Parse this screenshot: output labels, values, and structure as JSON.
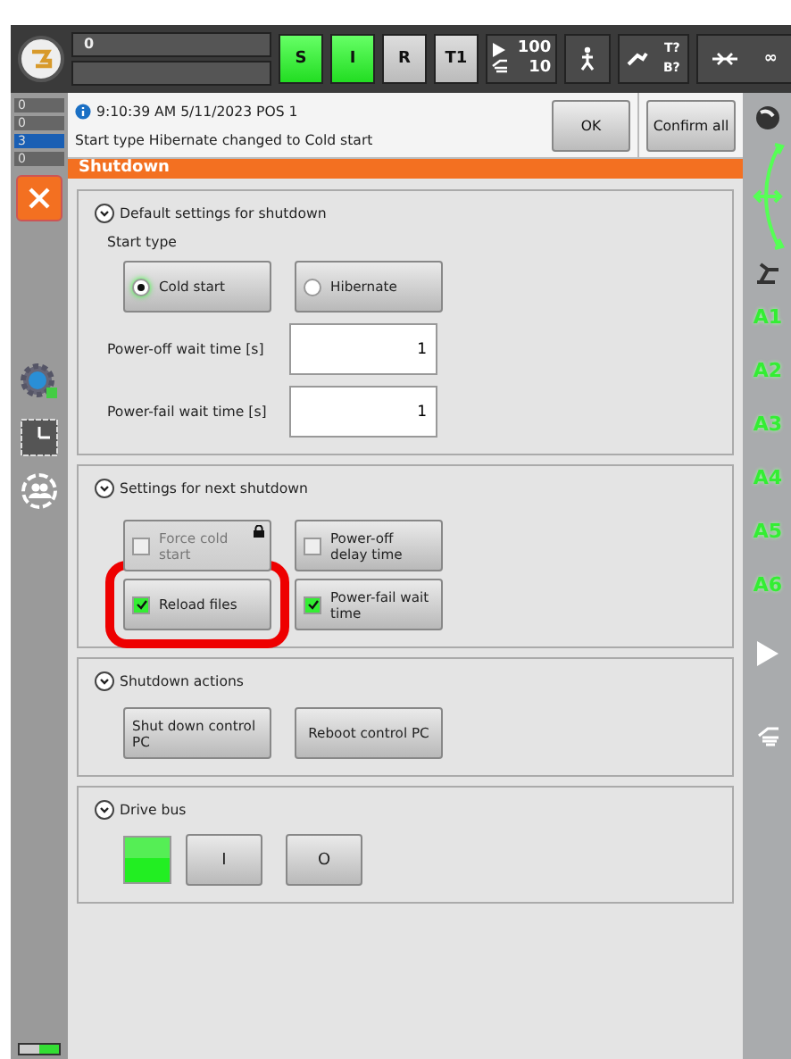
{
  "top_bar": {
    "program_field": "0",
    "status_buttons": [
      {
        "label": "S",
        "on": true
      },
      {
        "label": "I",
        "on": true
      },
      {
        "label": "R",
        "on": false
      },
      {
        "label": "T1",
        "on": false
      }
    ],
    "override": {
      "program": "100",
      "jog": "10"
    },
    "tool_base": {
      "tool": "T?",
      "base": "B?"
    },
    "increment": "∞"
  },
  "message_counters": [
    {
      "kind": "error",
      "count": "0"
    },
    {
      "kind": "warning",
      "count": "0"
    },
    {
      "kind": "info",
      "count": "3"
    },
    {
      "kind": "wait",
      "count": "0"
    }
  ],
  "message": {
    "time": "9:10:39 AM 5/11/2023 POS 1",
    "text": "Start type Hibernate changed to Cold start"
  },
  "message_buttons": [
    "OK",
    "Confirm all"
  ],
  "window": {
    "title": "Shutdown"
  },
  "sections": [
    {
      "kind": "defaults",
      "title": "Default settings for shutdown",
      "start_type_label": "Start type",
      "start_types": [
        {
          "label": "Cold start",
          "selected": true
        },
        {
          "label": "Hibernate",
          "selected": false
        }
      ],
      "fields": [
        {
          "label": "Power-off wait time [s]",
          "value": "1"
        },
        {
          "label": "Power-fail wait time [s]",
          "value": "1"
        }
      ]
    },
    {
      "kind": "options",
      "title": "Settings for next shutdown",
      "options": [
        {
          "label": "Force cold start",
          "checked": false,
          "disabled": true,
          "highlighted": false
        },
        {
          "label": "Power-off delay time",
          "checked": false,
          "disabled": false,
          "highlighted": false
        },
        {
          "label": "Reload files",
          "checked": true,
          "disabled": false,
          "highlighted": true
        },
        {
          "label": "Power-fail wait time",
          "checked": true,
          "disabled": false,
          "highlighted": false
        }
      ]
    },
    {
      "kind": "actions",
      "title": "Shutdown actions",
      "buttons": [
        "Shut down control PC",
        "Reboot control PC"
      ]
    },
    {
      "kind": "drive",
      "title": "Drive bus",
      "on": true,
      "buttons": [
        "I",
        "O"
      ]
    }
  ],
  "axes": [
    "A1",
    "A2",
    "A3",
    "A4",
    "A5",
    "A6"
  ]
}
